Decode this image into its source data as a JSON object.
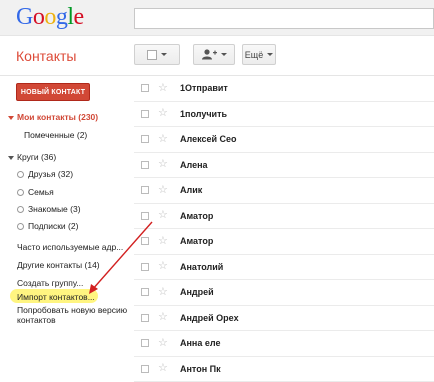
{
  "logo": {
    "letters": [
      "G",
      "o",
      "o",
      "g",
      "l",
      "e"
    ],
    "colors": [
      "#3369e8",
      "#d50f25",
      "#eeb211",
      "#3369e8",
      "#009925",
      "#d50f25"
    ]
  },
  "app_title": "Контакты",
  "toolbar": {
    "more_label": "Ещё"
  },
  "new_contact_label": "НОВЫЙ КОНТАКТ",
  "sidebar": {
    "my_contacts": "Мои контакты (230)",
    "starred": "Помеченные (2)",
    "circles": "Круги (36)",
    "friends": "Друзья (32)",
    "family": "Семья",
    "acquaintances": "Знакомые (3)",
    "following": "Подписки (2)",
    "frequent": "Часто используемые адр...",
    "other": "Другие контакты (14)",
    "create_group": "Создать группу...",
    "import": "Импорт контактов...",
    "try_new_1": "Попробовать новую версию",
    "try_new_2": "контактов"
  },
  "contacts": [
    "1Отправит",
    "1получить",
    "Алексей Сео",
    "Алена",
    "Алик",
    "Аматор",
    "Аматор",
    "Анатолий",
    "Андрей",
    "Андрей Орех",
    "Анна еле",
    "Антон Пк"
  ],
  "colors": {
    "accent": "#dd4b39",
    "button_red": "#d14836",
    "highlight": "#fff36b",
    "arrow": "#d22020"
  }
}
